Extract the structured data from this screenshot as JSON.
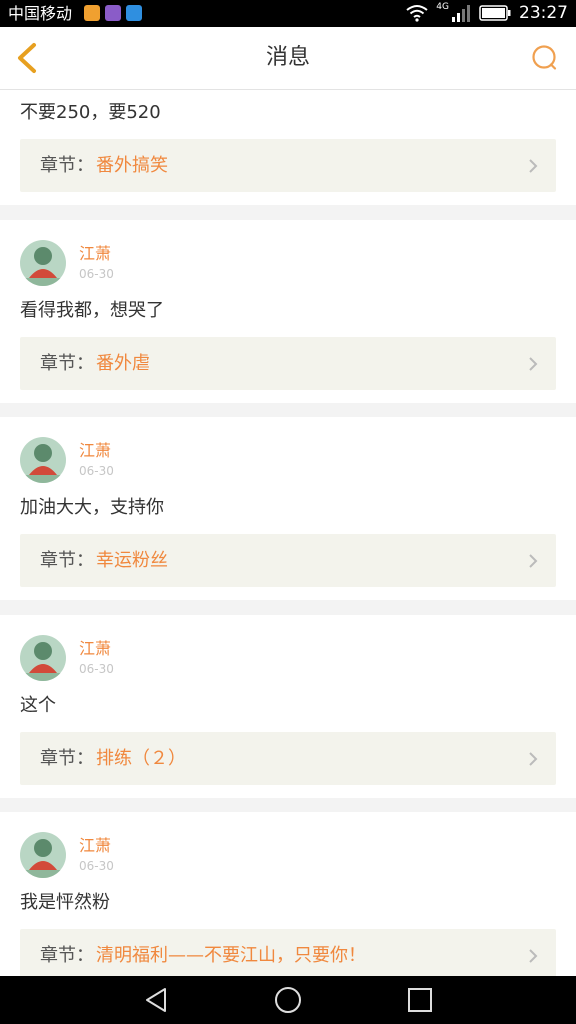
{
  "status_bar": {
    "carrier": "中国移动",
    "network": "4G",
    "time": "23:27"
  },
  "header": {
    "title": "消息"
  },
  "chapter_label": "章节：",
  "colors": {
    "accent": "#f0883e",
    "chapter_bg": "#f3f3ec"
  },
  "messages": [
    {
      "comment": "不要250，要520",
      "chapter": "番外搞笑"
    },
    {
      "author": "江萧",
      "date": "06-30",
      "comment": "看得我都，想哭了",
      "chapter": "番外虐"
    },
    {
      "author": "江萧",
      "date": "06-30",
      "comment": "加油大大，支持你",
      "chapter": "幸运粉丝"
    },
    {
      "author": "江萧",
      "date": "06-30",
      "comment": "这个",
      "chapter": "排练（２）"
    },
    {
      "author": "江萧",
      "date": "06-30",
      "comment": "我是怦然粉",
      "chapter": "清明福利——不要江山，只要你！"
    }
  ]
}
